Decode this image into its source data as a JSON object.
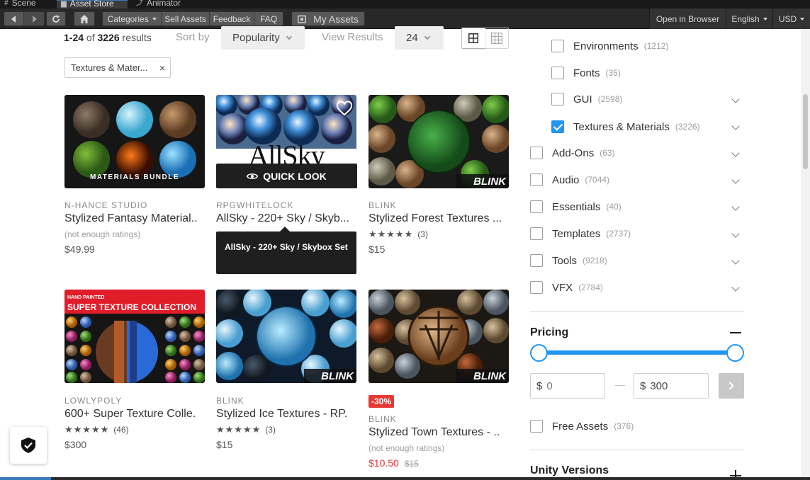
{
  "editor_tabs": [
    {
      "label": "Scene",
      "icon": "hash-icon"
    },
    {
      "label": "Asset Store",
      "icon": "store-icon"
    },
    {
      "label": "Animator",
      "icon": "animator-icon"
    }
  ],
  "toolbar": {
    "categories_label": "Categories",
    "sell_assets_label": "Sell Assets",
    "feedback_label": "Feedback",
    "faq_label": "FAQ",
    "my_assets_label": "My Assets",
    "open_in_browser_label": "Open in Browser",
    "language_label": "English",
    "currency_label": "USD"
  },
  "results": {
    "range": "1-24",
    "of_label": "of",
    "total": "3226",
    "suffix": "results",
    "sort_by_label": "Sort by",
    "sort_value": "Popularity",
    "view_results_label": "View Results",
    "per_page": "24"
  },
  "active_filter": {
    "label": "Textures & Mater..."
  },
  "cards": [
    {
      "publisher": "N-HANCE STUDIO",
      "title": "Stylized Fantasy Material..",
      "rating_text": "(not enough ratings)",
      "price": "$49.99",
      "thumb_text": "MATERIALS BUNDLE"
    },
    {
      "publisher": "RPGWHITELOCK",
      "title": "AllSky - 220+ Sky / Skyb...",
      "stars": "★★★★★",
      "price": "",
      "thumb_text": "AllSky"
    },
    {
      "publisher": "BLINK",
      "title": "Stylized Forest Textures ...",
      "stars": "★★★★★",
      "rating_count": "(3)",
      "price": "$15",
      "thumb_text": "BLINK"
    },
    {
      "publisher": "LOWLYPOLY",
      "title": "600+ Super Texture Colle.",
      "stars": "★★★★★",
      "rating_count": "(46)",
      "price": "$300",
      "thumb_text": "SUPER TEXTURE COLLECTION",
      "thumb_subtext": "HAND PAINTED"
    },
    {
      "publisher": "BLINK",
      "title": "Stylized Ice Textures - RP.",
      "stars": "★★★★★",
      "rating_count": "(3)",
      "price": "$15",
      "thumb_text": "BLINK"
    },
    {
      "publisher": "BLINK",
      "title": "Stylized Town Textures - ..",
      "rating_text": "(not enough ratings)",
      "price": "$10.50",
      "old_price": "$15",
      "badge": "-30%",
      "thumb_text": "BLINK"
    }
  ],
  "quick_look_label": "QUICK LOOK",
  "tooltip_text": "AllSky - 220+ Sky / Skybox Set",
  "filters": [
    {
      "label": "Environments",
      "count": "(1212)",
      "checked": false
    },
    {
      "label": "Fonts",
      "count": "(35)",
      "checked": false
    },
    {
      "label": "GUI",
      "count": "(2598)",
      "checked": false
    },
    {
      "label": "Textures & Materials",
      "count": "(3226)",
      "checked": true
    },
    {
      "label": "Add-Ons",
      "count": "(63)",
      "checked": false
    },
    {
      "label": "Audio",
      "count": "(7044)",
      "checked": false
    },
    {
      "label": "Essentials",
      "count": "(40)",
      "checked": false
    },
    {
      "label": "Templates",
      "count": "(2737)",
      "checked": false
    },
    {
      "label": "Tools",
      "count": "(9218)",
      "checked": false
    },
    {
      "label": "VFX",
      "count": "(2784)",
      "checked": false
    }
  ],
  "pricing": {
    "title": "Pricing",
    "currency_symbol": "$",
    "min_value": "0",
    "max_value": "300",
    "free_assets_label": "Free Assets",
    "free_assets_count": "(376)"
  },
  "unity_versions_title": "Unity Versions",
  "colors": {
    "accent": "#2196f3",
    "sale": "#e53935",
    "toolbar": "#282828"
  }
}
